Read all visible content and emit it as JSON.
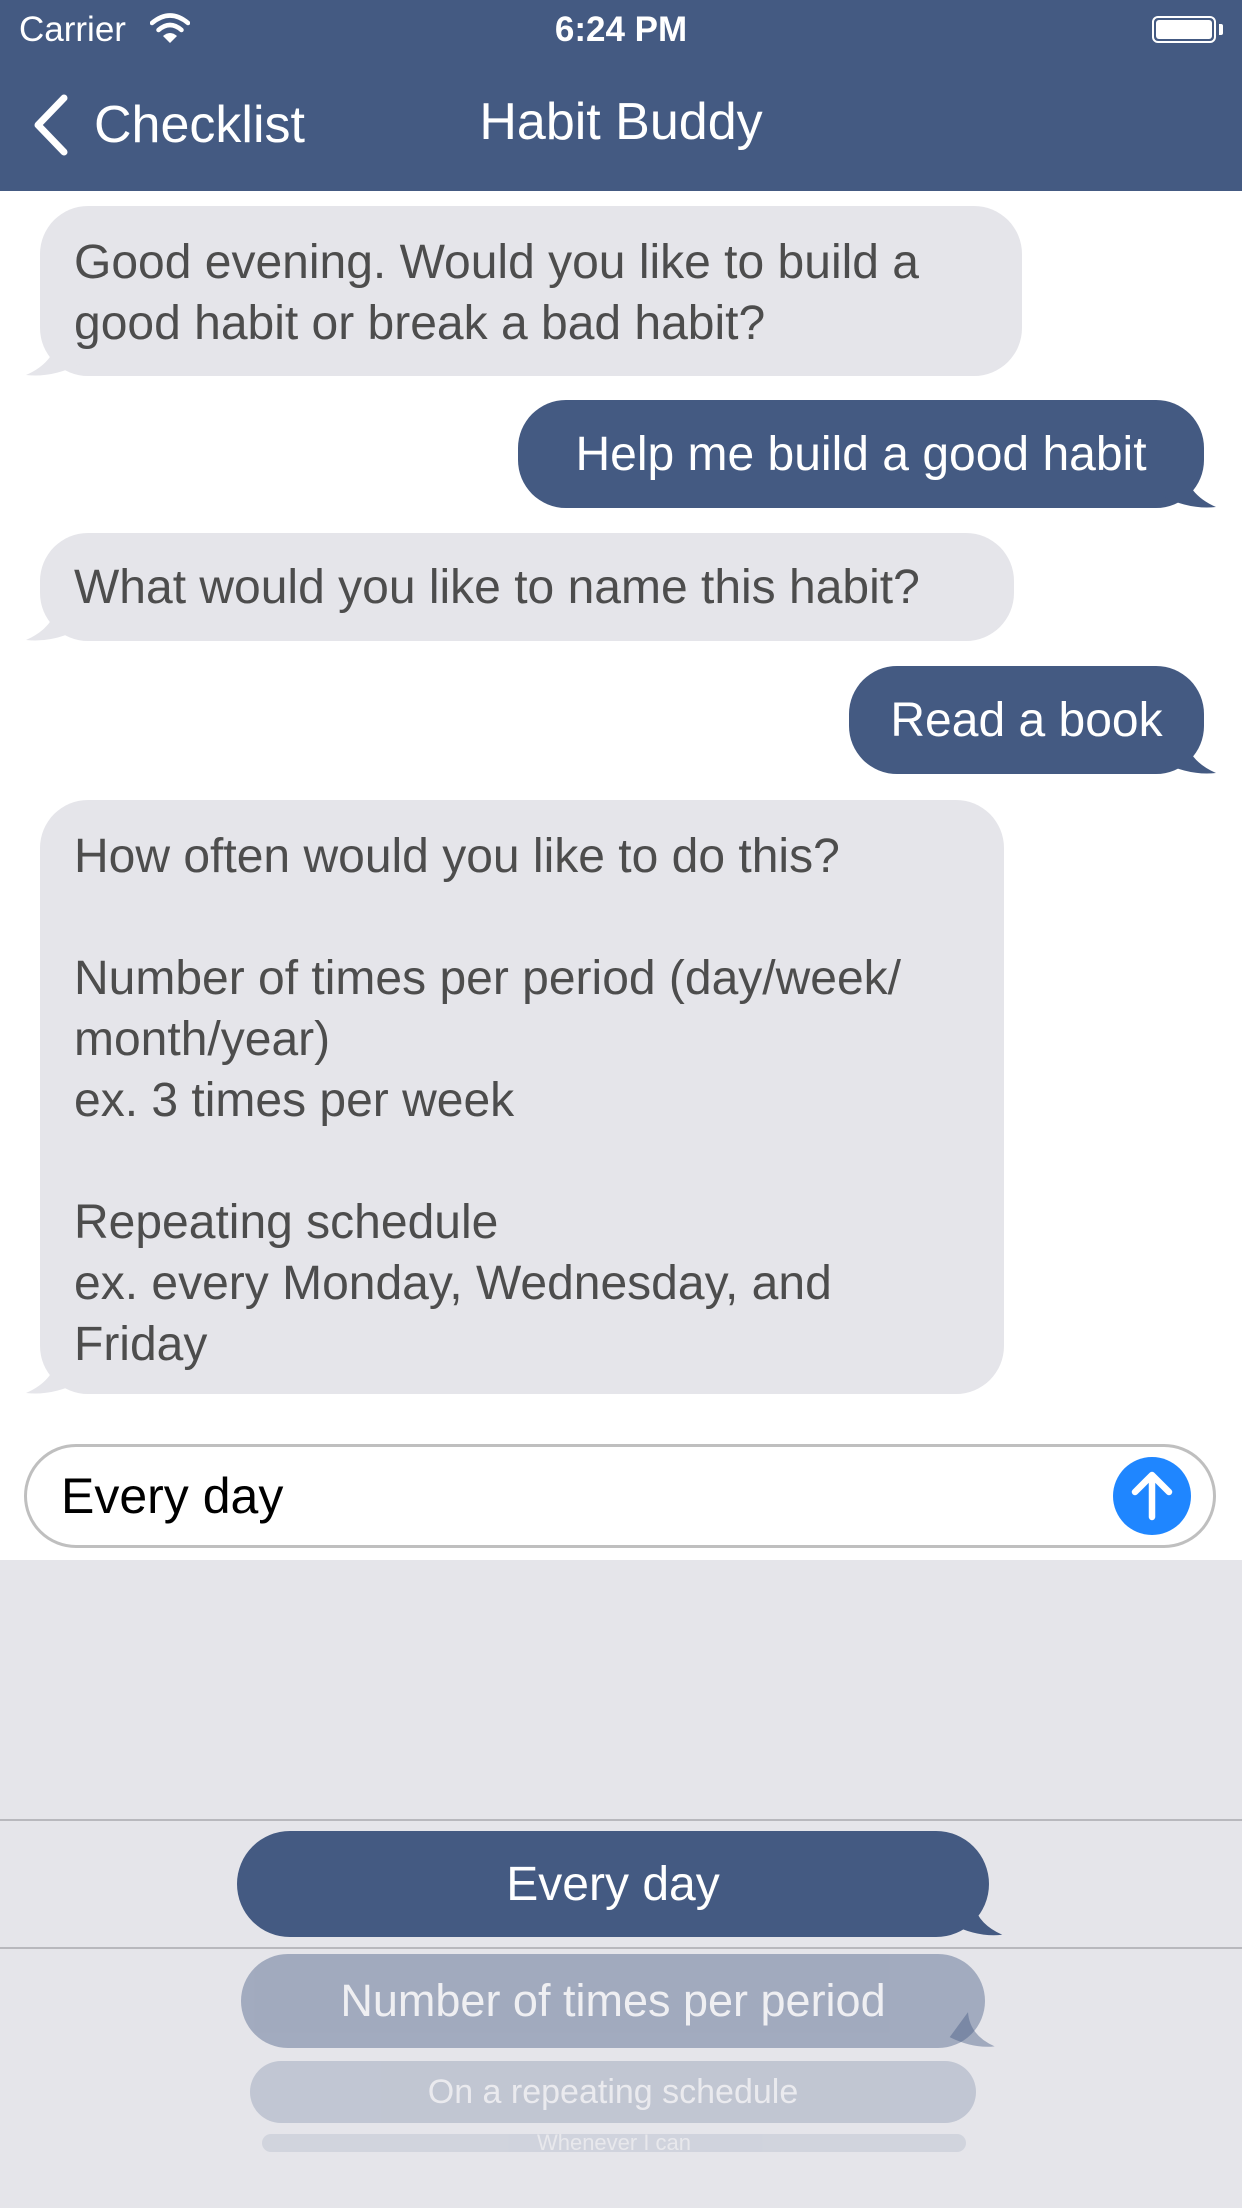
{
  "status_bar": {
    "carrier": "Carrier",
    "time": "6:24 PM"
  },
  "nav": {
    "back_label": "Checklist",
    "title": "Habit Buddy"
  },
  "messages": [
    {
      "sender": "bot",
      "text": "Good evening. Would you like to build a\ngood habit or break a bad habit?"
    },
    {
      "sender": "user",
      "text": "Help me build a good habit"
    },
    {
      "sender": "bot",
      "text": "What would you like to name this habit?"
    },
    {
      "sender": "user",
      "text": "Read a book"
    },
    {
      "sender": "bot",
      "text": "How often would you like to do this?\n\nNumber of times per period (day/week/\nmonth/year)\nex. 3 times per week\n\nRepeating schedule\nex. every Monday, Wednesday, and\nFriday"
    }
  ],
  "composer": {
    "value": "Every day"
  },
  "picker": {
    "options": [
      "Every day",
      "Number of times per period",
      "On a repeating schedule",
      "Whenever I can"
    ],
    "selected": "Every day"
  },
  "colors": {
    "nav_background": "#445a82",
    "bot_bubble": "#e5e5ea",
    "user_bubble": "#445a82",
    "send_button": "#1f86ff",
    "picker_background": "#e5e5ea"
  },
  "icons": {
    "back": "chevron-left-icon",
    "wifi": "wifi-icon",
    "battery": "battery-icon",
    "send": "arrow-up-icon"
  }
}
